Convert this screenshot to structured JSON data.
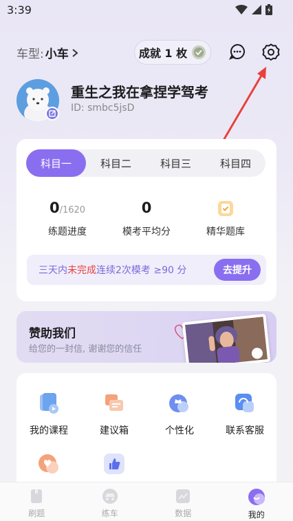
{
  "status_bar": {
    "time": "3:39"
  },
  "header": {
    "car_type_label": "车型:",
    "car_type_value": "小车",
    "achievement_label": "成就 1 枚"
  },
  "profile": {
    "username": "重生之我在拿捏学驾考",
    "user_id": "ID: smbc5jsD"
  },
  "subject_tabs": [
    {
      "label": "科目一",
      "active": true
    },
    {
      "label": "科目二",
      "active": false
    },
    {
      "label": "科目三",
      "active": false
    },
    {
      "label": "科目四",
      "active": false
    }
  ],
  "stats": {
    "progress_done": "0",
    "progress_total": "/1620",
    "progress_label": "练题进度",
    "avg_score": "0",
    "avg_score_label": "模考平均分",
    "bank_label": "精华题库"
  },
  "promo": {
    "text_before": "三天内",
    "text_highlight": "未完成",
    "text_after": "连续2次模考 ≥90 分",
    "button": "去提升"
  },
  "sponsor": {
    "title": "赞助我们",
    "subtitle": "给您的一封信, 谢谢您的信任"
  },
  "tools": [
    {
      "label": "我的课程",
      "icon": "course-icon"
    },
    {
      "label": "建议箱",
      "icon": "suggestion-icon"
    },
    {
      "label": "个性化",
      "icon": "personalize-icon"
    },
    {
      "label": "联系客服",
      "icon": "customer-service-icon"
    },
    {
      "label": "",
      "icon": "heart-hand-icon"
    },
    {
      "label": "",
      "icon": "thumbs-up-icon"
    }
  ],
  "bottom_nav": [
    {
      "label": "刷题",
      "active": false
    },
    {
      "label": "练车",
      "active": false
    },
    {
      "label": "数据",
      "active": false
    },
    {
      "label": "我的",
      "active": true
    }
  ],
  "colors": {
    "accent": "#8a6ef0",
    "annotation_arrow": "#e8413c",
    "highlight_red": "#e8413c"
  }
}
